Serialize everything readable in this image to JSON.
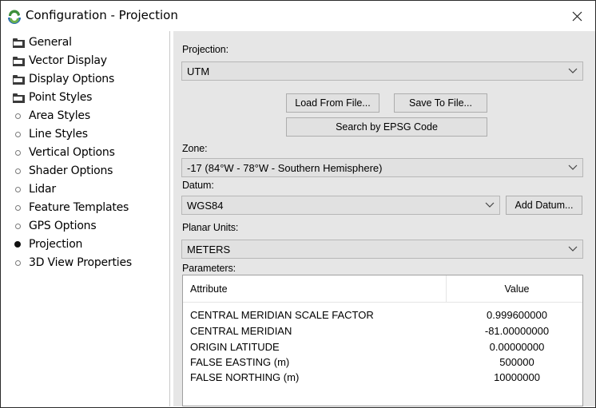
{
  "window": {
    "title": "Configuration - Projection",
    "close_symbol": "✕"
  },
  "tree": {
    "items": [
      {
        "label": "General",
        "icon": "folder-icon"
      },
      {
        "label": "Vector Display",
        "icon": "folder-icon"
      },
      {
        "label": "Display Options",
        "icon": "folder-icon"
      },
      {
        "label": "Point Styles",
        "icon": "folder-icon"
      },
      {
        "label": "Area Styles",
        "icon": "bullet-icon"
      },
      {
        "label": "Line Styles",
        "icon": "bullet-icon"
      },
      {
        "label": "Vertical Options",
        "icon": "bullet-icon"
      },
      {
        "label": "Shader Options",
        "icon": "bullet-icon"
      },
      {
        "label": "Lidar",
        "icon": "bullet-icon"
      },
      {
        "label": "Feature Templates",
        "icon": "bullet-icon"
      },
      {
        "label": "GPS Options",
        "icon": "bullet-icon"
      },
      {
        "label": "Projection",
        "icon": "bullet-selected-icon",
        "selected": true
      },
      {
        "label": "3D View Properties",
        "icon": "bullet-icon"
      }
    ]
  },
  "projection": {
    "label": "Projection:",
    "value": "UTM",
    "load_button": "Load From File...",
    "save_button": "Save To File...",
    "search_button": "Search by EPSG Code"
  },
  "zone": {
    "label": "Zone:",
    "value": "-17 (84°W - 78°W - Southern Hemisphere)"
  },
  "datum": {
    "label": "Datum:",
    "value": "WGS84",
    "add_button": "Add Datum..."
  },
  "planar_units": {
    "label": "Planar Units:",
    "value": "METERS"
  },
  "parameters": {
    "label": "Parameters:",
    "columns": [
      "Attribute",
      "Value"
    ],
    "rows": [
      {
        "attribute": "CENTRAL MERIDIAN SCALE FACTOR",
        "value": "0.999600000"
      },
      {
        "attribute": "CENTRAL MERIDIAN",
        "value": "-81.00000000"
      },
      {
        "attribute": "ORIGIN LATITUDE",
        "value": "0.00000000"
      },
      {
        "attribute": "FALSE EASTING (m)",
        "value": "500000"
      },
      {
        "attribute": "FALSE NORTHING (m)",
        "value": "10000000"
      }
    ]
  },
  "colors": {
    "panel_bg": "#e6e6e6",
    "control_bg": "#e1e1e1",
    "app_icon_green": "#3d8f3b",
    "app_icon_blue": "#2a6fb5"
  }
}
